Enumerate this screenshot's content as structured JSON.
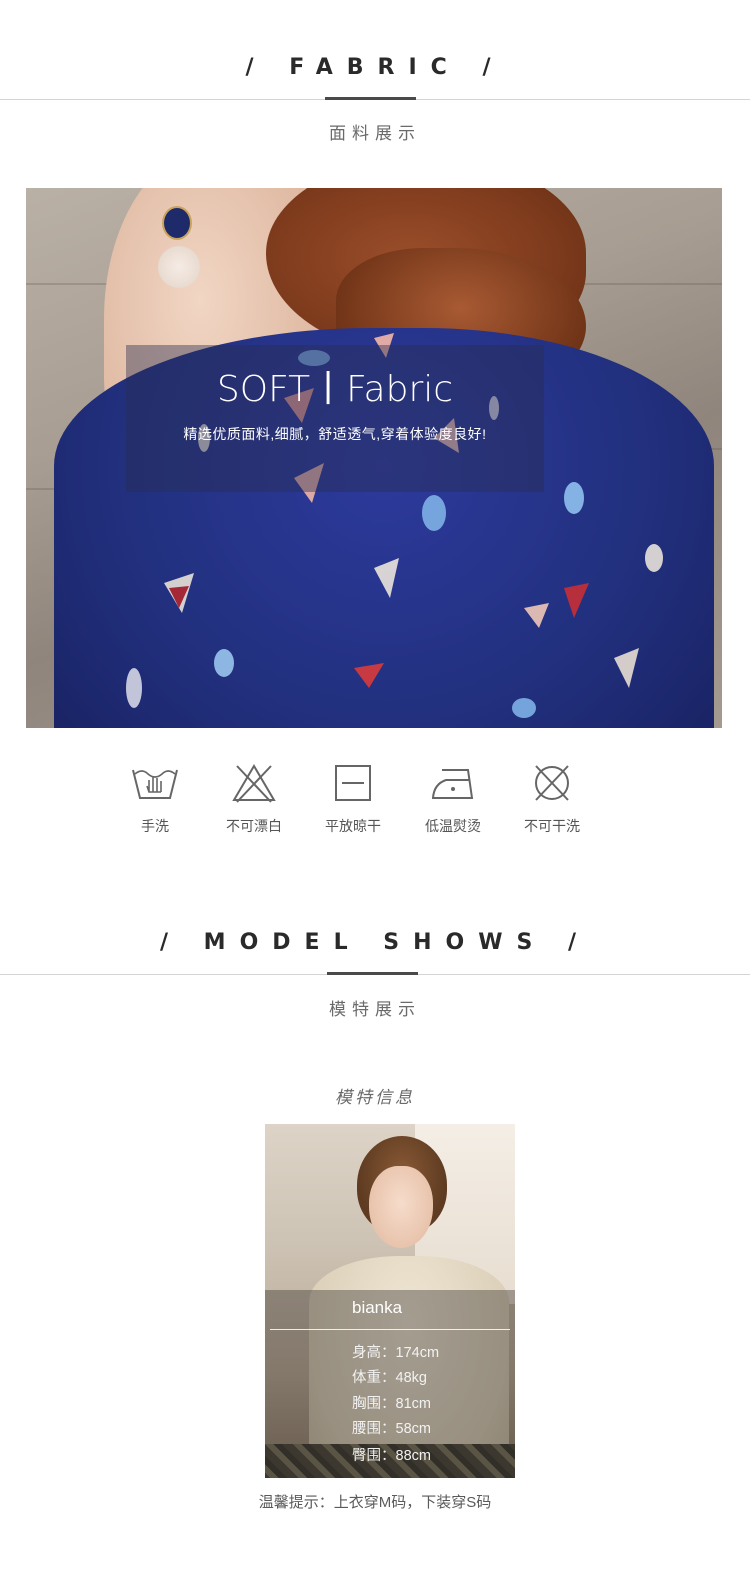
{
  "fabric_section": {
    "title": "/ FABRIC /",
    "subtitle": "面料展示",
    "photo": {
      "headline": "SOFT丨Fabric",
      "description": "精选优质面料,细腻，舒适透气,穿着体验度良好!"
    },
    "care_icons": [
      {
        "icon": "hand-wash-icon",
        "label": "手洗"
      },
      {
        "icon": "no-bleach-icon",
        "label": "不可漂白"
      },
      {
        "icon": "dry-flat-icon",
        "label": "平放晾干"
      },
      {
        "icon": "low-iron-icon",
        "label": "低温熨烫"
      },
      {
        "icon": "no-dry-clean-icon",
        "label": "不可干洗"
      }
    ]
  },
  "model_section": {
    "title": "/ MODEL SHOWS /",
    "subtitle": "模特展示",
    "info_title": "模特信息",
    "model": {
      "name": "bianka",
      "stats": [
        "身高：174cm",
        "体重：48kg",
        "胸围：81cm",
        "腰围：58cm",
        "臀围：88cm"
      ]
    },
    "tip": "温馨提示：上衣穿M码，下装穿S码"
  }
}
